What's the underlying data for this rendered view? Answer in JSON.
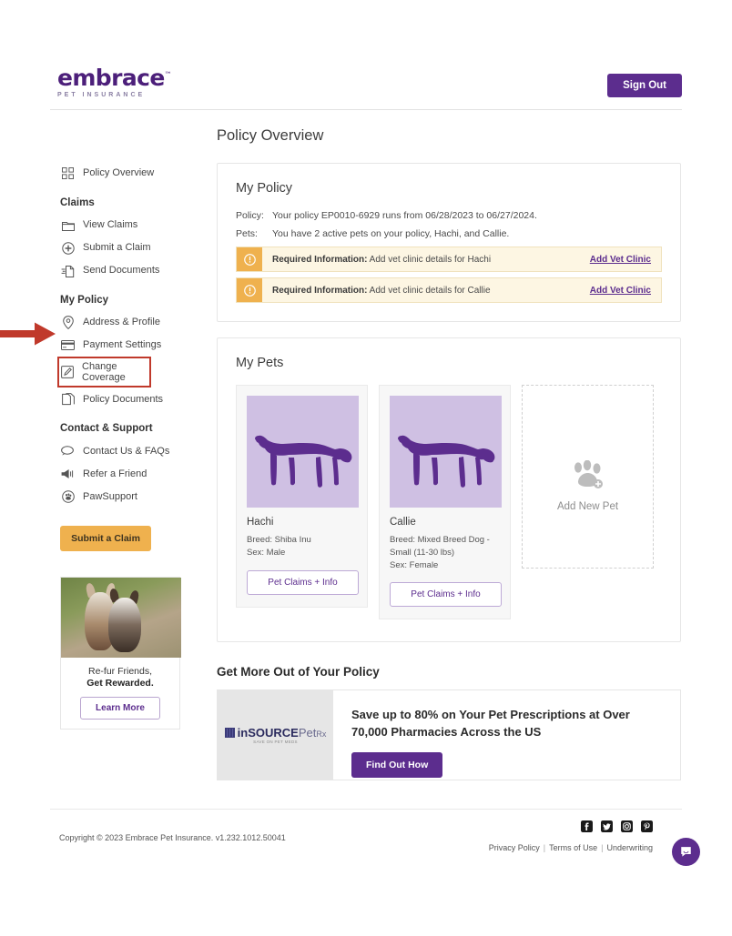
{
  "header": {
    "logo_word": "embrace",
    "logo_tm": "™",
    "logo_sub": "PET INSURANCE",
    "sign_out": "Sign Out"
  },
  "sidebar": {
    "items": [
      {
        "label": "Policy Overview",
        "icon": "grid-icon",
        "group": null
      },
      {
        "label": "Claims",
        "type": "group-title"
      },
      {
        "label": "View Claims",
        "icon": "folder-icon"
      },
      {
        "label": "Submit a Claim",
        "icon": "plus-circle-icon"
      },
      {
        "label": "Send Documents",
        "icon": "send-document-icon"
      },
      {
        "label": "My Policy",
        "type": "group-title"
      },
      {
        "label": "Address & Profile",
        "icon": "location-pin-icon"
      },
      {
        "label": "Payment Settings",
        "icon": "credit-card-icon"
      },
      {
        "label": "Change Coverage",
        "icon": "edit-pencil-icon",
        "highlighted": true
      },
      {
        "label": "Policy Documents",
        "icon": "copy-documents-icon"
      },
      {
        "label": "Contact & Support",
        "type": "group-title"
      },
      {
        "label": "Contact Us & FAQs",
        "icon": "chat-bubble-icon"
      },
      {
        "label": "Refer a Friend",
        "icon": "megaphone-icon"
      },
      {
        "label": "PawSupport",
        "icon": "paw-circle-icon"
      }
    ],
    "submit_claim_button": "Submit a Claim",
    "promo": {
      "line1": "Re-fur Friends,",
      "line2": "Get Rewarded.",
      "button": "Learn More"
    }
  },
  "main": {
    "page_title": "Policy Overview",
    "my_policy": {
      "title": "My Policy",
      "rows": [
        {
          "key": "Policy:",
          "value": "Your policy EP0010-6929 runs from 06/28/2023 to 06/27/2024."
        },
        {
          "key": "Pets:",
          "value": "You have 2 active pets on your policy, Hachi, and Callie."
        }
      ],
      "alerts": [
        {
          "label": "Required Information:",
          "text": " Add vet clinic details for Hachi",
          "link": "Add Vet Clinic"
        },
        {
          "label": "Required Information:",
          "text": " Add vet clinic details for Callie",
          "link": "Add Vet Clinic"
        }
      ]
    },
    "my_pets": {
      "title": "My Pets",
      "pets": [
        {
          "name": "Hachi",
          "breed_label": "Breed:",
          "breed": "Shiba Inu",
          "sex_label": "Sex:",
          "sex": "Male",
          "button": "Pet Claims + Info"
        },
        {
          "name": "Callie",
          "breed_label": "Breed:",
          "breed": "Mixed Breed Dog - Small (11-30 lbs)",
          "sex_label": "Sex:",
          "sex": "Female",
          "button": "Pet Claims + Info"
        }
      ],
      "add_new_pet": "Add New Pet"
    },
    "get_more": {
      "section_title": "Get More Out of Your Policy",
      "logo": {
        "in": "in",
        "source": "SOURCE",
        "pet": "Pet",
        "rx": "Rx",
        "tagline": "SAVE ON PET MEDS"
      },
      "headline": "Save up to 80% on Your Pet Prescriptions at Over 70,000 Pharmacies Across the US",
      "button": "Find Out How"
    }
  },
  "footer": {
    "copyright": "Copyright © 2023   Embrace Pet Insurance. v1.232.1012.50041",
    "socials": [
      "facebook-icon",
      "twitter-icon",
      "instagram-icon",
      "pinterest-icon"
    ],
    "links": [
      "Privacy Policy",
      "Terms of Use",
      "Underwriting"
    ]
  },
  "colors": {
    "brand_purple": "#5c2d8e",
    "logo_purple": "#4c1f7a",
    "accent_yellow": "#efb14e",
    "alert_bg": "#fdf6e3",
    "pet_photo_bg": "#cfc0e3",
    "annotation_red": "#c0392b"
  }
}
